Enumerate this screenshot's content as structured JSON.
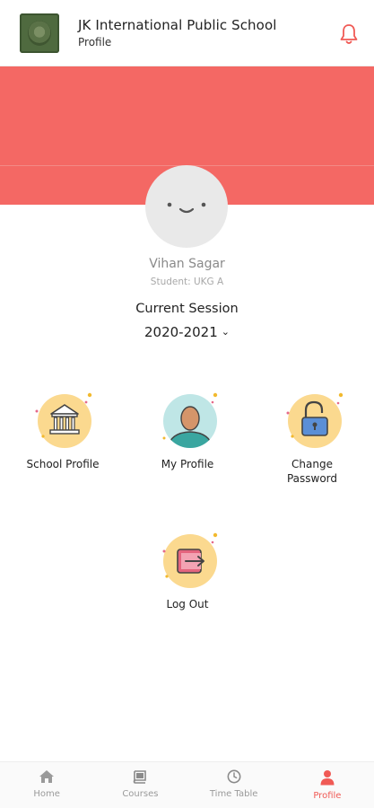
{
  "header": {
    "school_name": "JK International Public School",
    "subtitle": "Profile",
    "logo_icon": "school-crest",
    "notification_icon": "bell-icon"
  },
  "colors": {
    "accent": "#f46864",
    "active_nav": "#f05a55"
  },
  "profile": {
    "name": "Vihan Sagar",
    "class_info": "Student: UKG A",
    "session_label": "Current Session",
    "session_value": "2020-2021"
  },
  "menu": {
    "school_profile": "School Profile",
    "my_profile": "My Profile",
    "change_password": "Change Password",
    "log_out": "Log Out"
  },
  "nav": {
    "home": "Home",
    "courses": "Courses",
    "timetable": "Time Table",
    "profile": "Profile",
    "active": "profile"
  }
}
